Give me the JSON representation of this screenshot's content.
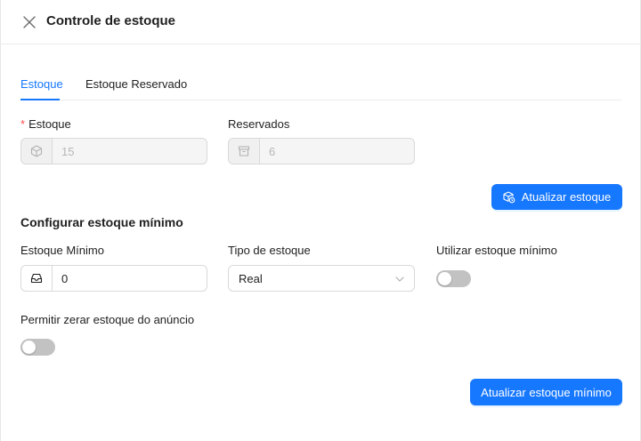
{
  "header": {
    "title": "Controle de estoque",
    "close_icon": "close-icon"
  },
  "tabs": [
    {
      "label": "Estoque",
      "active": true
    },
    {
      "label": "Estoque Reservado",
      "active": false
    }
  ],
  "stock": {
    "required_mark": "*",
    "label": "Estoque",
    "icon": "box-icon",
    "value": "15",
    "disabled": true
  },
  "reserved": {
    "label": "Reservados",
    "icon": "archive-icon",
    "value": "6",
    "disabled": true
  },
  "update_stock_button": {
    "label": "Atualizar estoque",
    "icon": "box-refresh-icon"
  },
  "min_section": {
    "title": "Configurar estoque mínimo",
    "min_stock": {
      "label": "Estoque Mínimo",
      "icon": "inbox-icon",
      "value": "0"
    },
    "stock_type": {
      "label": "Tipo de estoque",
      "selected": "Real"
    },
    "use_min": {
      "label": "Utilizar estoque mínimo",
      "checked": false
    },
    "allow_zero": {
      "label": "Permitir zerar estoque do anúncio",
      "checked": false
    }
  },
  "update_min_button": {
    "label": "Atualizar estoque mínimo"
  },
  "colors": {
    "primary": "#1677ff",
    "required": "#ff4d4f",
    "switch_off": "#c2c2c2"
  }
}
